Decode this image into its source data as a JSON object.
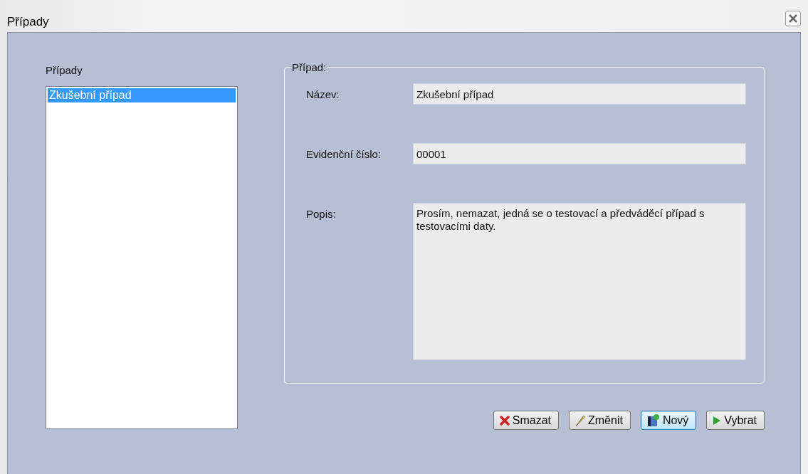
{
  "window": {
    "title": "Případy"
  },
  "list": {
    "label": "Případy",
    "items": [
      {
        "label": "Zkušební případ",
        "selected": true
      }
    ]
  },
  "group": {
    "title": "Případ:",
    "fields": [
      {
        "label": "Název:",
        "value": "Zkušební případ",
        "kind": "line"
      },
      {
        "label": "Evidenční číslo:",
        "value": "00001",
        "kind": "line"
      },
      {
        "label": "Popis:",
        "value": "Prosím, nemazat, jedná se o testovací a předváděcí případ s testovacími daty.",
        "kind": "memo"
      }
    ]
  },
  "buttons": [
    {
      "label": "Smazat",
      "kind": "delete",
      "focused": false
    },
    {
      "label": "Změnit",
      "kind": "edit",
      "focused": false
    },
    {
      "label": "Nový",
      "kind": "new",
      "focused": true
    },
    {
      "label": "Vybrat",
      "kind": "select",
      "focused": false
    }
  ]
}
